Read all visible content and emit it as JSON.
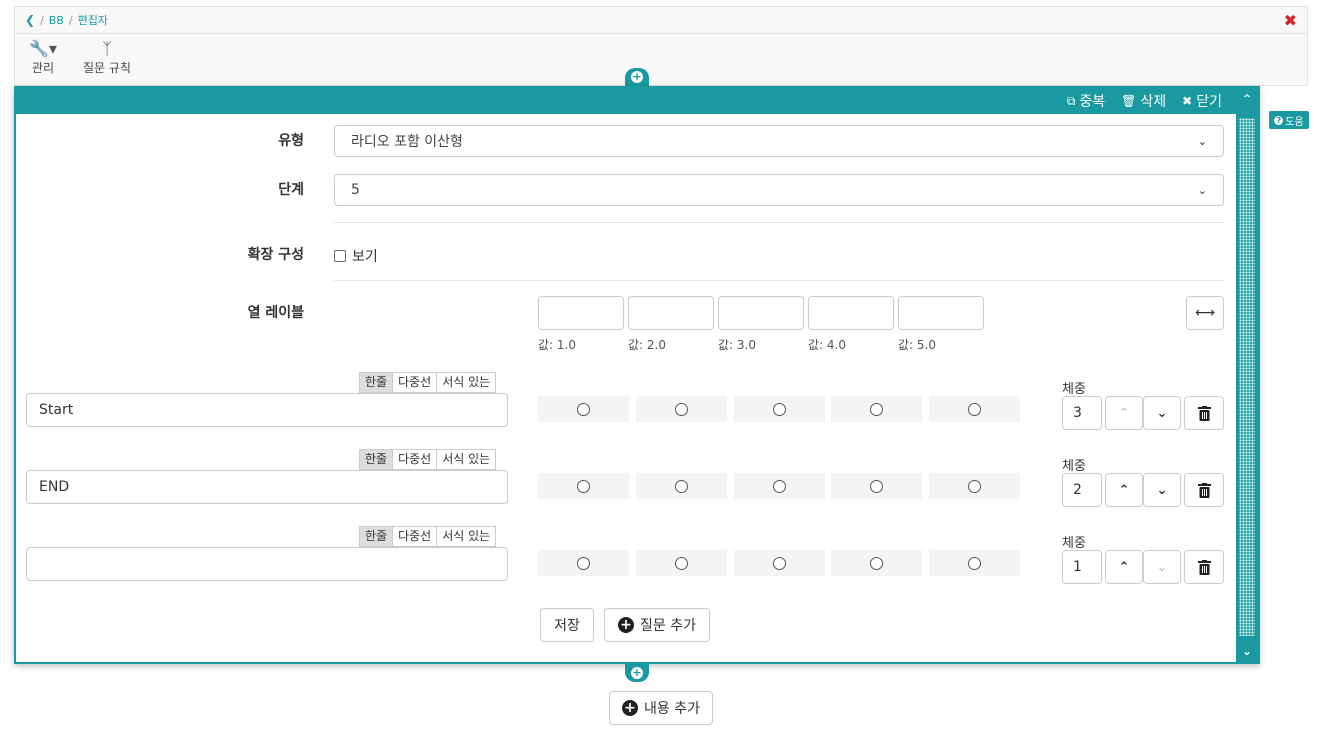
{
  "breadcrumb": {
    "root": "BB",
    "current": "편집자"
  },
  "toolbar": {
    "manage_label": "관리",
    "rules_label": "질문 규칙"
  },
  "panel": {
    "duplicate_label": "중복",
    "delete_label": "삭제",
    "close_label": "닫기"
  },
  "help": {
    "label": "도움"
  },
  "form": {
    "type_label": "유형",
    "type_value": "라디오 포함 이산형",
    "level_label": "단계",
    "level_value": "5",
    "extended_label": "확장 구성",
    "extended_checkbox_label": "보기",
    "extended_checked": false,
    "column_labels_title": "열 레이블",
    "columns": [
      {
        "text": "",
        "value_label": "값: 1.0"
      },
      {
        "text": "",
        "value_label": "값: 2.0"
      },
      {
        "text": "",
        "value_label": "값: 3.0"
      },
      {
        "text": "",
        "value_label": "값: 4.0"
      },
      {
        "text": "",
        "value_label": "값: 5.0"
      }
    ]
  },
  "mode_tabs": [
    "한줄",
    "다중선",
    "서식 있는"
  ],
  "weight_label": "체중",
  "questions": [
    {
      "text": "Start",
      "weight": "3",
      "mode_active": "한줄",
      "up_enabled": false,
      "down_enabled": true
    },
    {
      "text": "END",
      "weight": "2",
      "mode_active": "한줄",
      "up_enabled": true,
      "down_enabled": true
    },
    {
      "text": "",
      "weight": "1",
      "mode_active": "한줄",
      "up_enabled": true,
      "down_enabled": false
    }
  ],
  "actions": {
    "save_label": "저장",
    "add_question_label": "질문 추가",
    "add_content_label": "내용 추가"
  },
  "colors": {
    "accent": "#1a9aa0",
    "close": "#d9232d"
  }
}
